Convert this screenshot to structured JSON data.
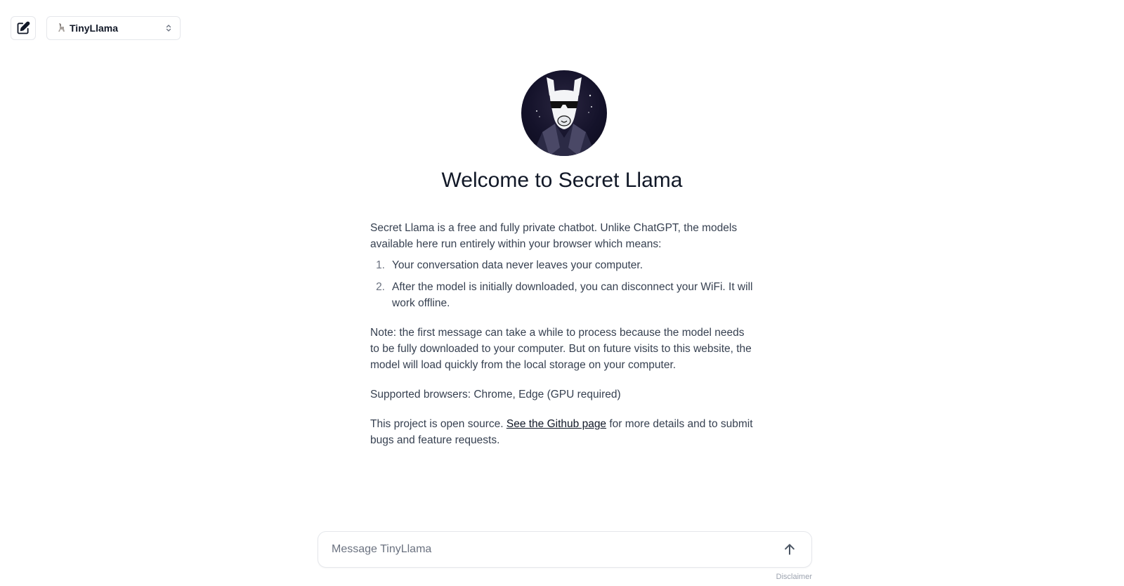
{
  "header": {
    "new_chat_icon": "edit-square-icon",
    "model_selector": {
      "icon": "llama-icon",
      "selected": "TinyLlama",
      "chevron_icon": "chevron-up-down-icon"
    }
  },
  "main": {
    "logo": "secret-llama-avatar",
    "title": "Welcome to Secret Llama",
    "intro": "Secret Llama is a free and fully private chatbot. Unlike ChatGPT, the models available here run entirely within your browser which means:",
    "points": [
      {
        "num": "1.",
        "text": "Your conversation data never leaves your computer."
      },
      {
        "num": "2.",
        "text": "After the model is initially downloaded, you can disconnect your WiFi. It will work offline."
      }
    ],
    "note": "Note: the first message can take a while to process because the model needs to be fully downloaded to your computer. But on future visits to this website, the model will load quickly from the local storage on your computer.",
    "browsers": "Supported browsers: Chrome, Edge (GPU required)",
    "open_source_prefix": "This project is open source.",
    "github_link": "See the Github page",
    "open_source_suffix": "for more details and to submit bugs and feature requests."
  },
  "composer": {
    "placeholder": "Message TinyLlama",
    "value": "",
    "send_icon": "arrow-up-icon"
  },
  "footer": {
    "disclaimer": "Disclaimer"
  },
  "colors": {
    "text": "#374151",
    "heading": "#111827",
    "border": "#e5e7eb",
    "muted": "#9ca3af"
  }
}
